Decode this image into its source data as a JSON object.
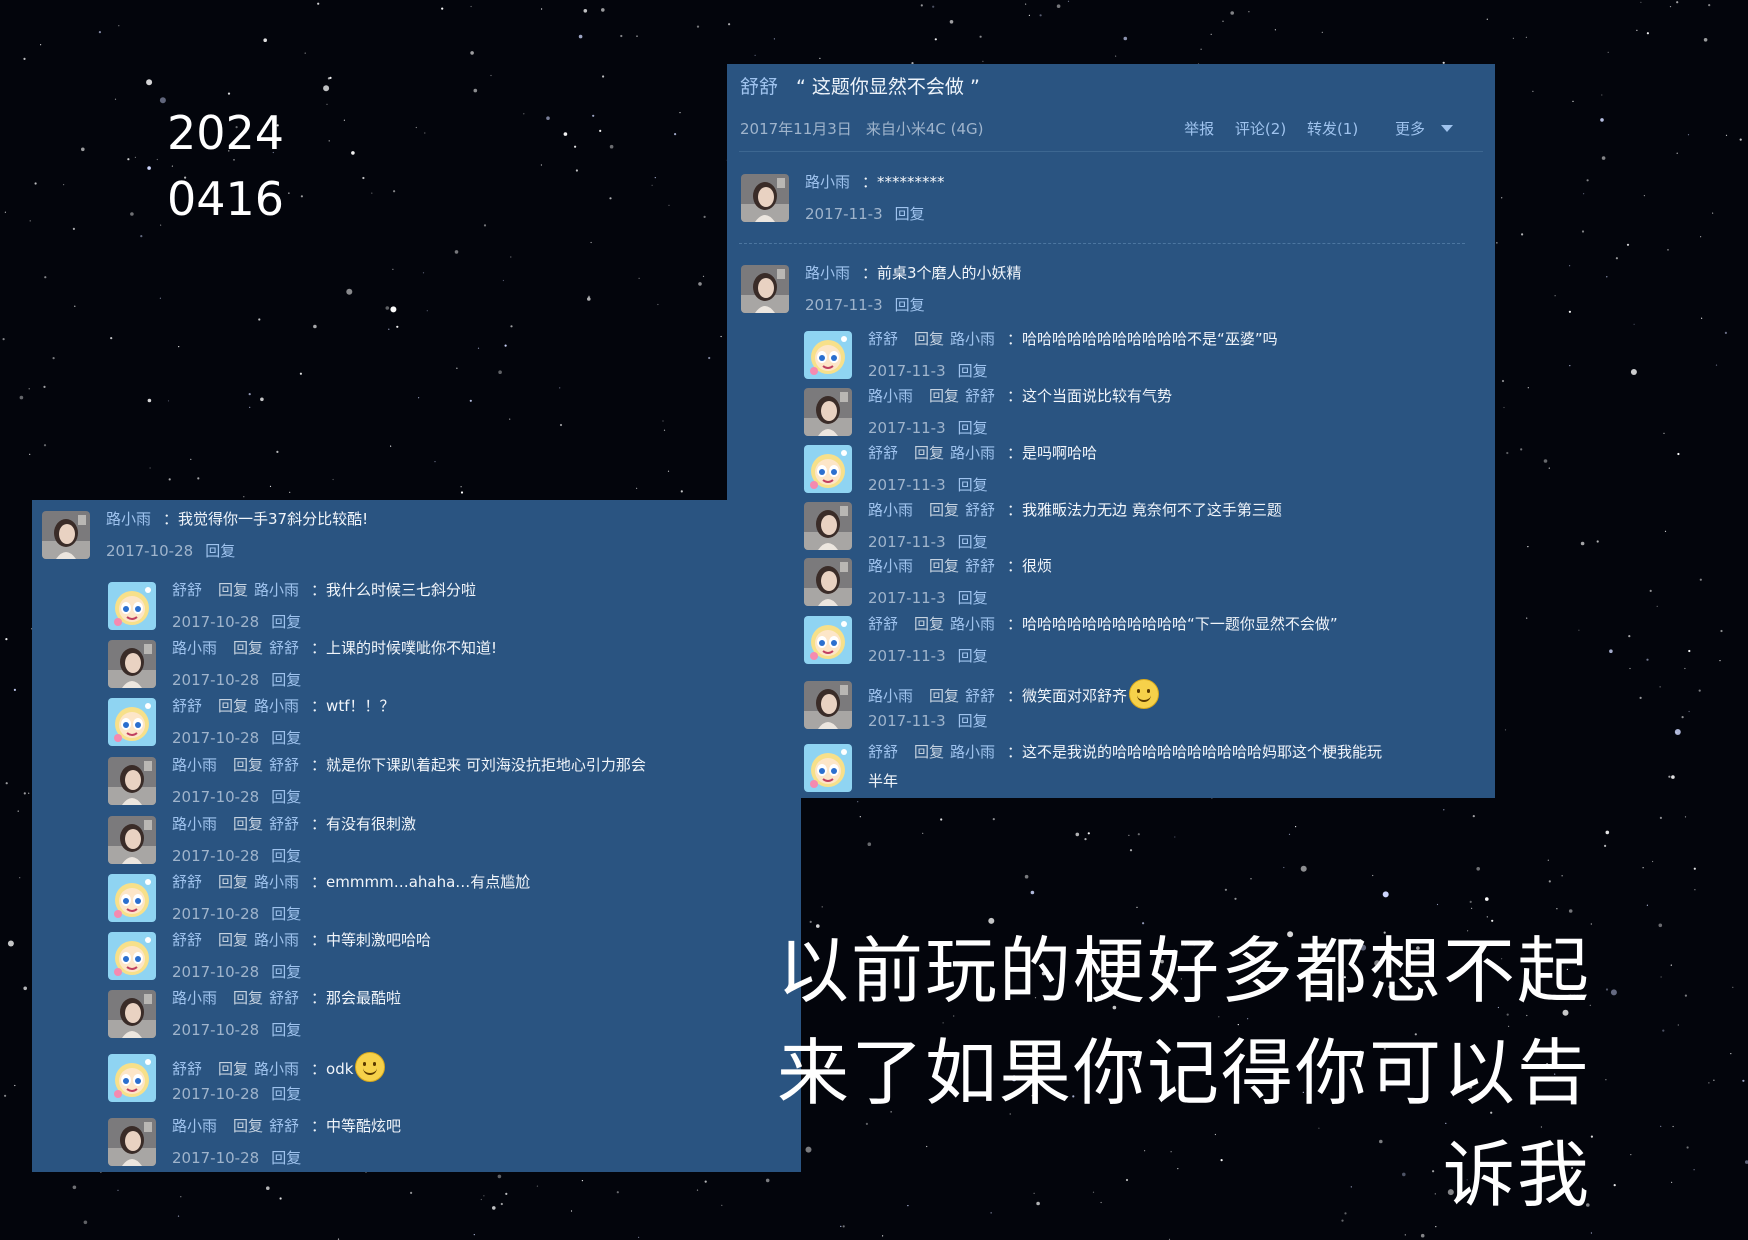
{
  "date_stamp": {
    "line1": "2024",
    "line2": "0416"
  },
  "caption": {
    "line1": "以前玩的梗好多都想不起",
    "line2": "来了如果你记得你可以告",
    "line3": "诉我"
  },
  "verb_reply": "回复",
  "right_panel": {
    "author": "舒舒",
    "title": "“ 这题你显然不会做 ”",
    "date": "2017年11月3日",
    "source": "来自小米4C (4G)",
    "actions": {
      "report": "举报",
      "comments": "评论(2)",
      "reposts": "转发(1)",
      "more": "更多"
    },
    "comments": [
      {
        "user": "路小雨",
        "text": "：*********",
        "date": "2017-11-3",
        "reply": "回复",
        "avatar": "girl"
      },
      {
        "user": "路小雨",
        "text": "：前桌3个磨人的小妖精",
        "date": "2017-11-3",
        "reply": "回复",
        "avatar": "girl"
      },
      {
        "user": "舒舒",
        "to": "路小雨",
        "text": "：哈哈哈哈哈哈哈哈哈哈哈不是“巫婆”吗",
        "date": "2017-11-3",
        "reply": "回复",
        "avatar": "puff"
      },
      {
        "user": "路小雨",
        "to": "舒舒",
        "text": "：这个当面说比较有气势",
        "date": "2017-11-3",
        "reply": "回复",
        "avatar": "girl"
      },
      {
        "user": "舒舒",
        "to": "路小雨",
        "text": "：是吗啊哈哈",
        "date": "2017-11-3",
        "reply": "回复",
        "avatar": "puff"
      },
      {
        "user": "路小雨",
        "to": "舒舒",
        "text": "：我雅畈法力无边 竟奈何不了这手第三题",
        "date": "2017-11-3",
        "reply": "回复",
        "avatar": "girl"
      },
      {
        "user": "路小雨",
        "to": "舒舒",
        "text": "：很烦",
        "date": "2017-11-3",
        "reply": "回复",
        "avatar": "girl"
      },
      {
        "user": "舒舒",
        "to": "路小雨",
        "text": "：哈哈哈哈哈哈哈哈哈哈哈“下一题你显然不会做”",
        "date": "2017-11-3",
        "reply": "回复",
        "avatar": "puff"
      },
      {
        "user": "路小雨",
        "to": "舒舒",
        "text": "：微笑面对邓舒齐",
        "date": "2017-11-3",
        "reply": "回复",
        "avatar": "girl",
        "emoji": "smile-emoji"
      },
      {
        "user": "舒舒",
        "to": "路小雨",
        "text": "：这不是我说的哈哈哈哈哈哈哈哈哈哈妈耶这个梗我能玩",
        "text2": "半年",
        "avatar": "puff"
      }
    ]
  },
  "left_panel": {
    "comments": [
      {
        "user": "路小雨",
        "text": "：我觉得你一手37斜分比较酷!",
        "date": "2017-10-28",
        "reply": "回复",
        "avatar": "girl"
      },
      {
        "user": "舒舒",
        "to": "路小雨",
        "text": "：我什么时候三七斜分啦",
        "date": "2017-10-28",
        "reply": "回复",
        "avatar": "puff"
      },
      {
        "user": "路小雨",
        "to": "舒舒",
        "text": "：上课的时候噗呲你不知道!",
        "date": "2017-10-28",
        "reply": "回复",
        "avatar": "girl"
      },
      {
        "user": "舒舒",
        "to": "路小雨",
        "text": "：wtf！！？",
        "date": "2017-10-28",
        "reply": "回复",
        "avatar": "puff"
      },
      {
        "user": "路小雨",
        "to": "舒舒",
        "text": "：就是你下课趴着起来 可刘海没抗拒地心引力那会",
        "date": "2017-10-28",
        "reply": "回复",
        "avatar": "girl"
      },
      {
        "user": "路小雨",
        "to": "舒舒",
        "text": "：有没有很刺激",
        "date": "2017-10-28",
        "reply": "回复",
        "avatar": "girl"
      },
      {
        "user": "舒舒",
        "to": "路小雨",
        "text": "：emmmm…ahaha…有点尴尬",
        "date": "2017-10-28",
        "reply": "回复",
        "avatar": "puff"
      },
      {
        "user": "舒舒",
        "to": "路小雨",
        "text": "：中等刺激吧哈哈",
        "date": "2017-10-28",
        "reply": "回复",
        "avatar": "puff"
      },
      {
        "user": "路小雨",
        "to": "舒舒",
        "text": "：那会最酷啦",
        "date": "2017-10-28",
        "reply": "回复",
        "avatar": "girl"
      },
      {
        "user": "舒舒",
        "to": "路小雨",
        "text": "：odk",
        "date": "2017-10-28",
        "reply": "回复",
        "avatar": "puff",
        "emoji": "smile-emoji"
      },
      {
        "user": "路小雨",
        "to": "舒舒",
        "text": "：中等酷炫吧",
        "date": "2017-10-28",
        "reply": "回复",
        "avatar": "girl"
      }
    ]
  }
}
